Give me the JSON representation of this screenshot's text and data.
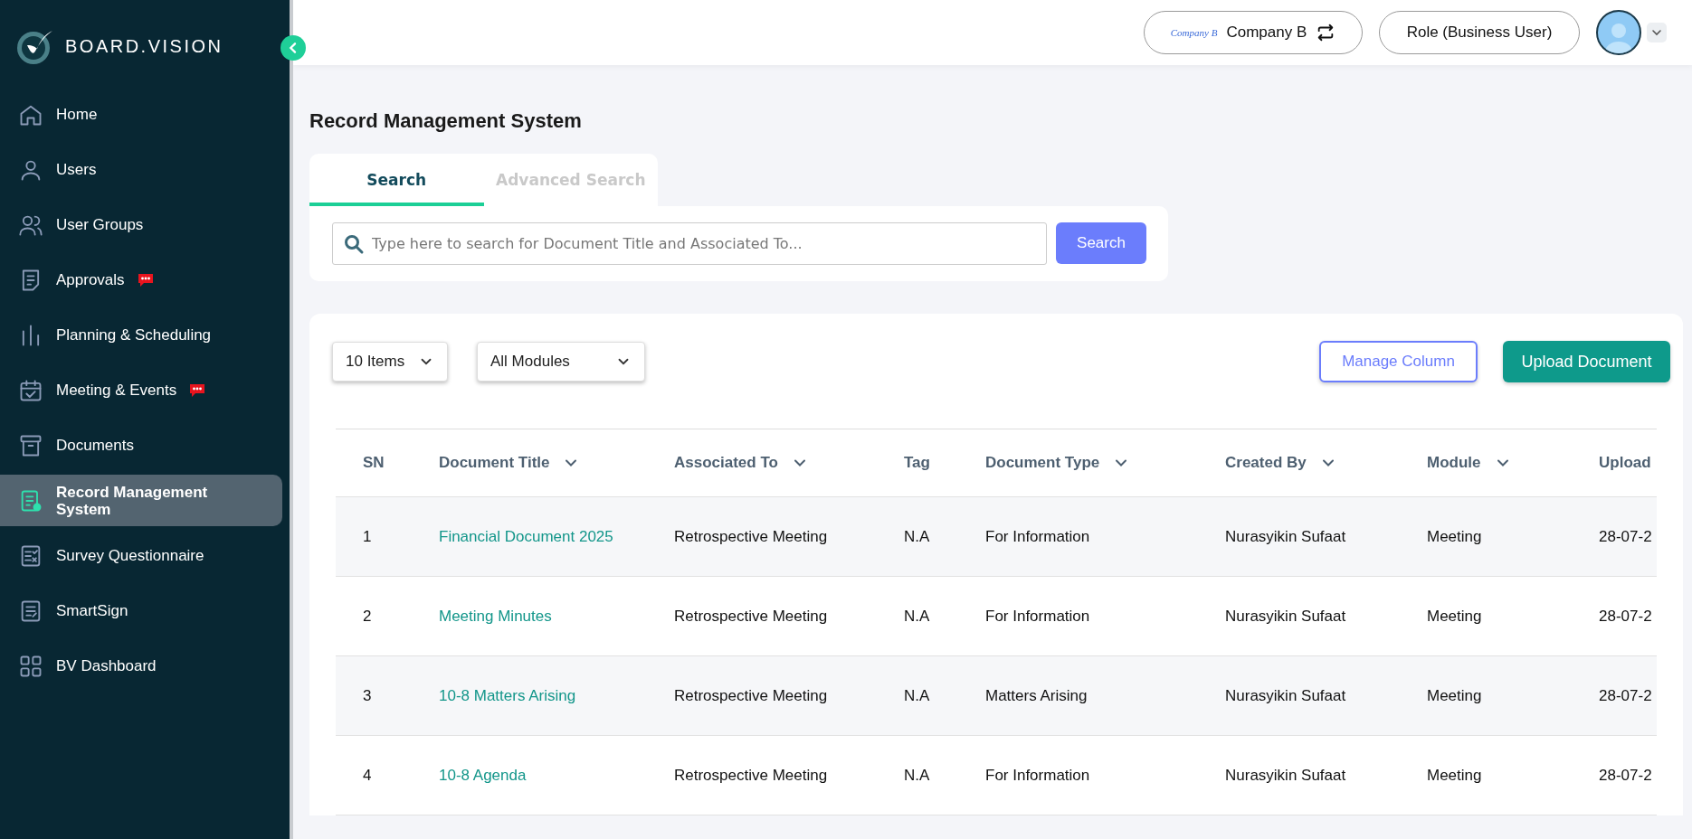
{
  "sidebar": {
    "brand": "BOARD.VISION",
    "items": [
      {
        "label": "Home",
        "selected": false,
        "notification": false
      },
      {
        "label": "Users",
        "selected": false,
        "notification": false
      },
      {
        "label": "User Groups",
        "selected": false,
        "notification": false
      },
      {
        "label": "Approvals",
        "selected": false,
        "notification": true
      },
      {
        "label": "Planning & Scheduling",
        "selected": false,
        "notification": false
      },
      {
        "label": "Meeting & Events",
        "selected": false,
        "notification": true
      },
      {
        "label": "Documents",
        "selected": false,
        "notification": false
      },
      {
        "label": "Record Management System",
        "selected": true,
        "notification": false
      },
      {
        "label": "Survey Questionnaire",
        "selected": false,
        "notification": false
      },
      {
        "label": "SmartSign",
        "selected": false,
        "notification": false
      },
      {
        "label": "BV Dashboard",
        "selected": false,
        "notification": false
      }
    ]
  },
  "topbar": {
    "company_logo": "Company B",
    "company": "Company B",
    "role": "Role (Business User)"
  },
  "page_title": "Record Management System",
  "tabs": [
    {
      "label": "Search",
      "selected": true
    },
    {
      "label": "Advanced Search",
      "selected": false
    }
  ],
  "search": {
    "placeholder": "Type here to search for Document Title and Associated To...",
    "button": "Search"
  },
  "filters": [
    "10 Items",
    "All Modules"
  ],
  "actions": {
    "manage": "Manage Column",
    "upload": "Upload Document"
  },
  "table": {
    "columns": [
      {
        "label": "SN",
        "sortable": false
      },
      {
        "label": "Document Title",
        "sortable": true
      },
      {
        "label": "Associated To",
        "sortable": true
      },
      {
        "label": "Tag",
        "sortable": false
      },
      {
        "label": "Document Type",
        "sortable": true
      },
      {
        "label": "Created By",
        "sortable": true
      },
      {
        "label": "Module",
        "sortable": true
      },
      {
        "label": "Upload",
        "sortable": false
      }
    ],
    "rows": [
      [
        "1",
        "Financial Document 2025",
        "Retrospective Meeting",
        "N.A",
        "For Information",
        "Nurasyikin Sufaat",
        "Meeting",
        "28-07-2"
      ],
      [
        "2",
        "Meeting Minutes",
        "Retrospective Meeting",
        "N.A",
        "For Information",
        "Nurasyikin Sufaat",
        "Meeting",
        "28-07-2"
      ],
      [
        "3",
        "10-8 Matters Arising",
        "Retrospective Meeting",
        "N.A",
        "Matters Arising",
        "Nurasyikin Sufaat",
        "Meeting",
        "28-07-2"
      ],
      [
        "4",
        "10-8 Agenda",
        "Retrospective Meeting",
        "N.A",
        "For Information",
        "Nurasyikin Sufaat",
        "Meeting",
        "28-07-2"
      ]
    ]
  }
}
